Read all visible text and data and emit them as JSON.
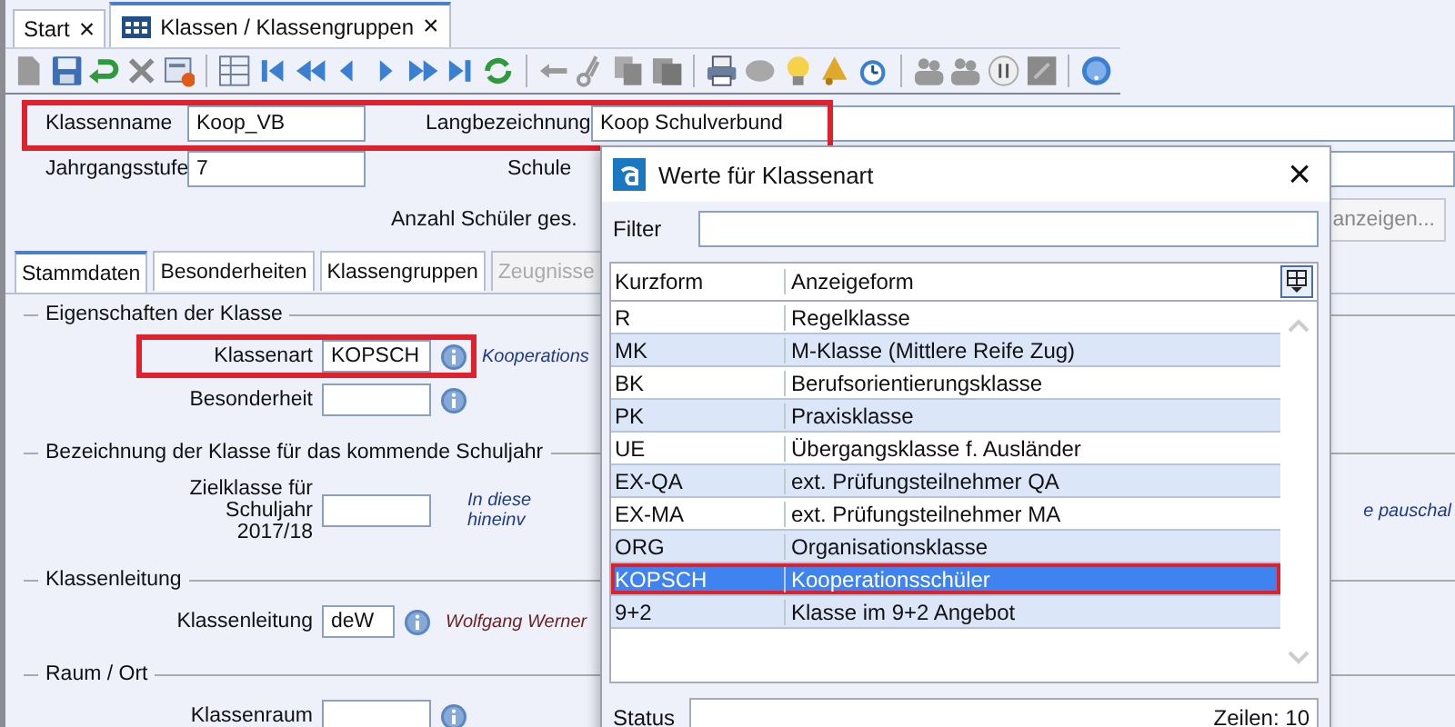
{
  "tabs": [
    {
      "label": "Start",
      "selected": false,
      "close": "×"
    },
    {
      "label": "Klassen / Klassengruppen",
      "selected": true,
      "close": "×"
    }
  ],
  "header": {
    "highlight": true,
    "fields": [
      {
        "label": "Klassenname",
        "value": "Koop_VB"
      },
      {
        "label": "Langbezeichnung",
        "value": "Koop Schulverbund"
      }
    ]
  },
  "jahrgangsstufe": {
    "label": "Jahrgangsstufe",
    "value": "7"
  },
  "schule": {
    "label": "Schule"
  },
  "anzahl": {
    "label": "Anzahl Schüler ges.",
    "button": "anzeigen..."
  },
  "section_tabs": [
    {
      "label": "Stammdaten",
      "selected": true,
      "disabled": false
    },
    {
      "label": "Besonderheiten",
      "selected": false,
      "disabled": false
    },
    {
      "label": "Klassengruppen",
      "selected": false,
      "disabled": false
    },
    {
      "label": "Zeugnisse",
      "selected": false,
      "disabled": true
    }
  ],
  "sections": [
    {
      "title": "Eigenschaften der Klasse",
      "rows": [
        {
          "label": "Klassenart",
          "value": "KOPSCH",
          "info": true,
          "hint": "Kooperations",
          "color": "#1f3a8a",
          "highlight": true
        },
        {
          "label": "Besonderheit",
          "info": true,
          "highlight": false
        }
      ]
    },
    {
      "title": "Bezeichnung der Klasse für das kommende Schuljahr",
      "rows": [
        {
          "label": "Zielklasse für Schuljahr 2017/18",
          "info": false,
          "hint_lines": [
            "In diese",
            "hineinv"
          ],
          "color": "#1f3a8a",
          "far_right": "e pauschal",
          "highlight": false
        }
      ]
    },
    {
      "title": "Klassenleitung",
      "rows": [
        {
          "label": "Klassenleitung",
          "value": "deW",
          "info": true,
          "hint": "Wolfgang Werner",
          "color": "#6b1f1f",
          "highlight": false,
          "short": true
        }
      ]
    },
    {
      "title": "Raum / Ort",
      "rows": [
        {
          "label": "Klassenraum",
          "info": true,
          "highlight": false
        }
      ]
    }
  ],
  "dialog": {
    "title": "Werte für Klassenart",
    "close": "×",
    "filter_label": "Filter",
    "columns": [
      "Kurzform",
      "Anzeigeform"
    ],
    "rows": [
      {
        "kurz": "R",
        "anzeige": "Regelklasse",
        "selected": false,
        "highlight": false
      },
      {
        "kurz": "MK",
        "anzeige": "M-Klasse (Mittlere Reife Zug)",
        "selected": false,
        "highlight": false
      },
      {
        "kurz": "BK",
        "anzeige": "Berufsorientierungsklasse",
        "selected": false,
        "highlight": false
      },
      {
        "kurz": "PK",
        "anzeige": "Praxisklasse",
        "selected": false,
        "highlight": false
      },
      {
        "kurz": "UE",
        "anzeige": "Übergangsklasse f. Ausländer",
        "selected": false,
        "highlight": false
      },
      {
        "kurz": "EX-QA",
        "anzeige": "ext. Prüfungsteilnehmer QA",
        "selected": false,
        "highlight": false
      },
      {
        "kurz": "EX-MA",
        "anzeige": "ext. Prüfungsteilnehmer MA",
        "selected": false,
        "highlight": false
      },
      {
        "kurz": "ORG",
        "anzeige": "Organisationsklasse",
        "selected": false,
        "highlight": false
      },
      {
        "kurz": "KOPSCH",
        "anzeige": "Kooperationsschüler",
        "selected": true,
        "highlight": true
      },
      {
        "kurz": "9+2",
        "anzeige": "Klasse im 9+2 Angebot",
        "selected": false,
        "highlight": false
      }
    ],
    "status_label": "Status",
    "status_value": "Zeilen: 10"
  }
}
